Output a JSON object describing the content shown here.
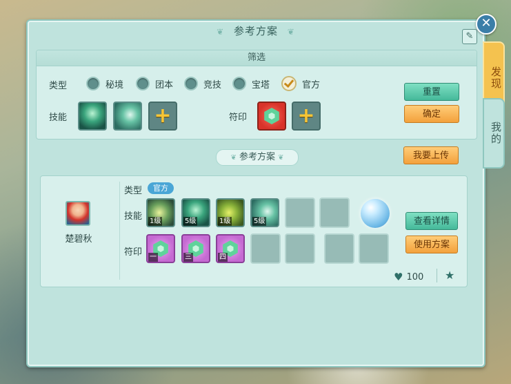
{
  "panel": {
    "title": "参考方案",
    "title_ornament": "❦",
    "edit_icon_glyph": "✎",
    "close_glyph": "✕"
  },
  "side_tabs": [
    {
      "label": "发现",
      "active": true
    },
    {
      "label": "我的",
      "active": false
    }
  ],
  "filter": {
    "header": "筛选",
    "type_label": "类型",
    "types": [
      {
        "label": "秘境",
        "checked": false
      },
      {
        "label": "团本",
        "checked": false
      },
      {
        "label": "竞技",
        "checked": false
      },
      {
        "label": "宝塔",
        "checked": false
      },
      {
        "label": "官方",
        "checked": true
      }
    ],
    "skill_label": "技能",
    "rune_label": "符印",
    "plus_glyph": "+",
    "reset_label": "重置",
    "confirm_label": "确定"
  },
  "upload_label": "我要上传",
  "section_title": "参考方案",
  "plan": {
    "character_name": "楚碧秋",
    "type_label": "类型",
    "type_tag": "官方",
    "skill_label": "技能",
    "rune_label": "符印",
    "skills": [
      {
        "level": "1级",
        "style": "skill-d"
      },
      {
        "level": "5级",
        "style": "skill-a"
      },
      {
        "level": "1级",
        "style": "skill-c"
      },
      {
        "level": "5级",
        "style": "skill-b"
      }
    ],
    "runes": [
      {
        "label": "一"
      },
      {
        "label": "三"
      },
      {
        "label": "四"
      }
    ],
    "details_label": "查看详情",
    "use_label": "使用方案",
    "likes": "100",
    "heart_glyph": "♥",
    "star_glyph": "★"
  },
  "colors": {
    "panel_bg": "#bfe3dd",
    "green_button": "#45b99a",
    "orange_button": "#f3a13c",
    "official_tag": "#4aa6d6",
    "active_tab": "#f4c24f"
  }
}
